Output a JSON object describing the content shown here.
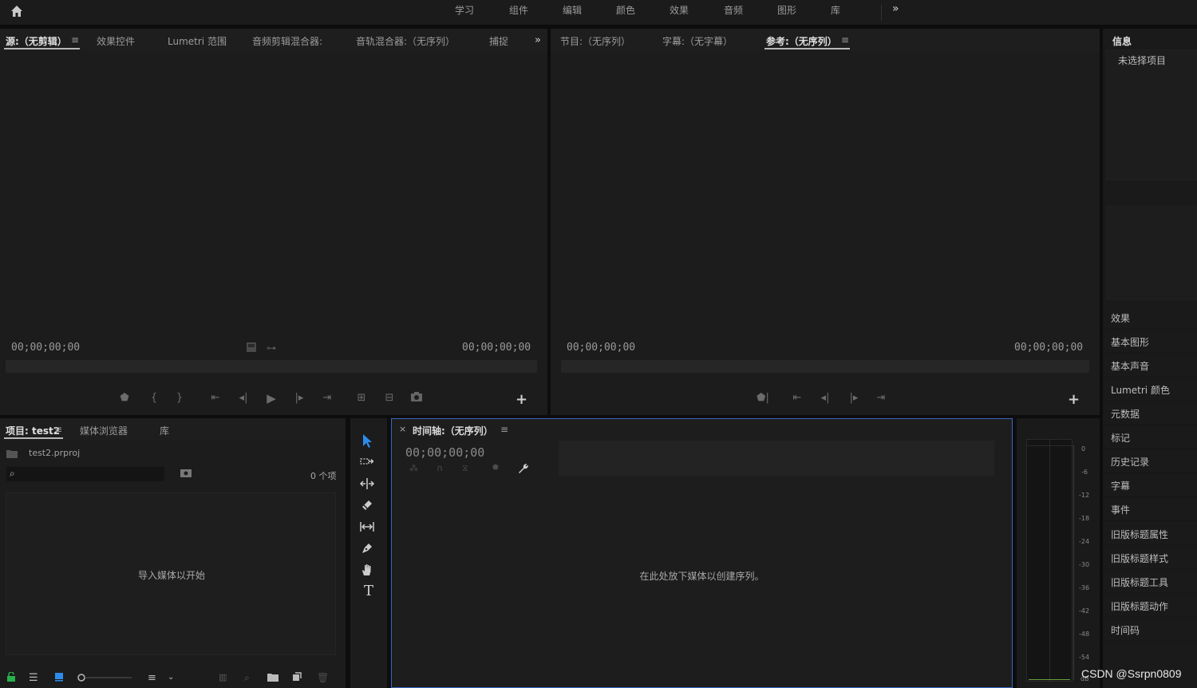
{
  "workspaces": [
    "学习",
    "组件",
    "编辑",
    "颜色",
    "效果",
    "音频",
    "图形",
    "库"
  ],
  "overflow_glyph": "»",
  "source_panel": {
    "tabs": [
      "源:（无剪辑）",
      "效果控件",
      "Lumetri 范围",
      "音频剪辑混合器:",
      "音轨混合器:（无序列）",
      "捕捉"
    ],
    "tc_left": "00;00;00;00",
    "tc_right": "00;00;00;00"
  },
  "program_panel": {
    "tabs": [
      "节目:（无序列）",
      "字幕:（无字幕）",
      "参考:（无序列）"
    ],
    "tc_left": "00;00;00;00",
    "tc_right": "00;00;00;00"
  },
  "info_panel": {
    "title": "信息",
    "empty_text": "未选择项目",
    "items": [
      "效果",
      "基本图形",
      "基本声音",
      "Lumetri 颜色",
      "元数据",
      "标记",
      "历史记录",
      "字幕",
      "事件",
      "旧版标题属性",
      "旧版标题样式",
      "旧版标题工具",
      "旧版标题动作",
      "时间码"
    ]
  },
  "project_panel": {
    "tabs": [
      "项目: test2",
      "媒体浏览器",
      "库"
    ],
    "file_name": "test2.prproj",
    "item_count": "0 个项",
    "search_placeholder": "",
    "empty_text": "导入媒体以开始"
  },
  "timeline_panel": {
    "close_glyph": "×",
    "title": "时间轴:（无序列）",
    "tc": "00;00;00;00",
    "empty_text": "在此处放下媒体以创建序列。"
  },
  "meter": {
    "scale": [
      "0",
      "-6",
      "-12",
      "-18",
      "-24",
      "-30",
      "-36",
      "-42",
      "-48",
      "-54",
      "dB"
    ]
  },
  "tools": {
    "type_glyph": "T"
  },
  "watermark": "CSDN @Ssrpn0809",
  "colors": {
    "selection_tool": "#2d8ceb",
    "timeline_border": "#3b66c4",
    "lock_icon": "#28b04a"
  }
}
